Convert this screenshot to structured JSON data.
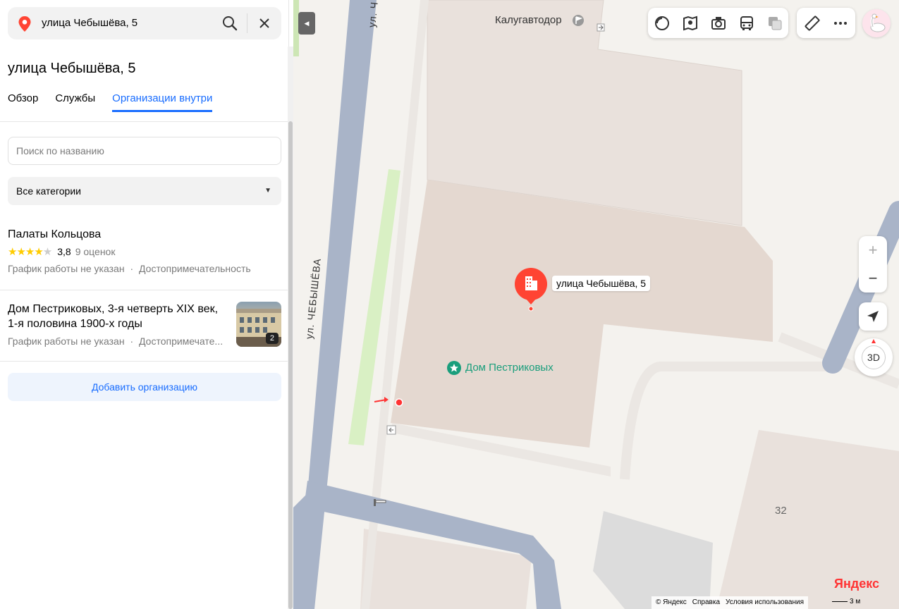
{
  "search": {
    "query": "улица Чебышёва, 5"
  },
  "place": {
    "title": "улица Чебышёва, 5"
  },
  "tabs": [
    {
      "label": "Обзор",
      "active": false
    },
    {
      "label": "Службы",
      "active": false
    },
    {
      "label": "Организации внутри",
      "active": true
    }
  ],
  "filter": {
    "placeholder": "Поиск по названию",
    "category": "Все категории"
  },
  "organizations": [
    {
      "name": "Палаты Кольцова",
      "rating": "3,8",
      "stars_filled": 4,
      "reviews": "9 оценок",
      "hours": "График работы не указан",
      "separator": "·",
      "category": "Достопримечательность"
    },
    {
      "name": "Дом Пестриковых, 3-я четверть XIX век, 1-я половина 1900-х годы",
      "hours": "График работы не указан",
      "separator": "·",
      "category": "Достопримечате...",
      "photo_count": "2"
    }
  ],
  "add_org_label": "Добавить организацию",
  "map": {
    "marker_label": "улица Чебышёва, 5",
    "poi_label": "Дом Пестриковых",
    "top_label": "Калугавтодор",
    "street_label": "ул. ЧЕБЫШЁВА",
    "street_label_top": "ул. Ч",
    "house_number": "32",
    "zoom_in": "+",
    "zoom_out": "−",
    "compass_label": "3D",
    "logo_red": "Я",
    "logo_black": "ндекс",
    "copyright": "© Яндекс",
    "help": "Справка",
    "terms": "Условия использования",
    "scale": "3 м"
  },
  "colors": {
    "accent": "#196dff",
    "marker": "#f43",
    "poi": "#1a9e7c",
    "building": "#e4d8d0",
    "road": "#a9b4c8"
  }
}
